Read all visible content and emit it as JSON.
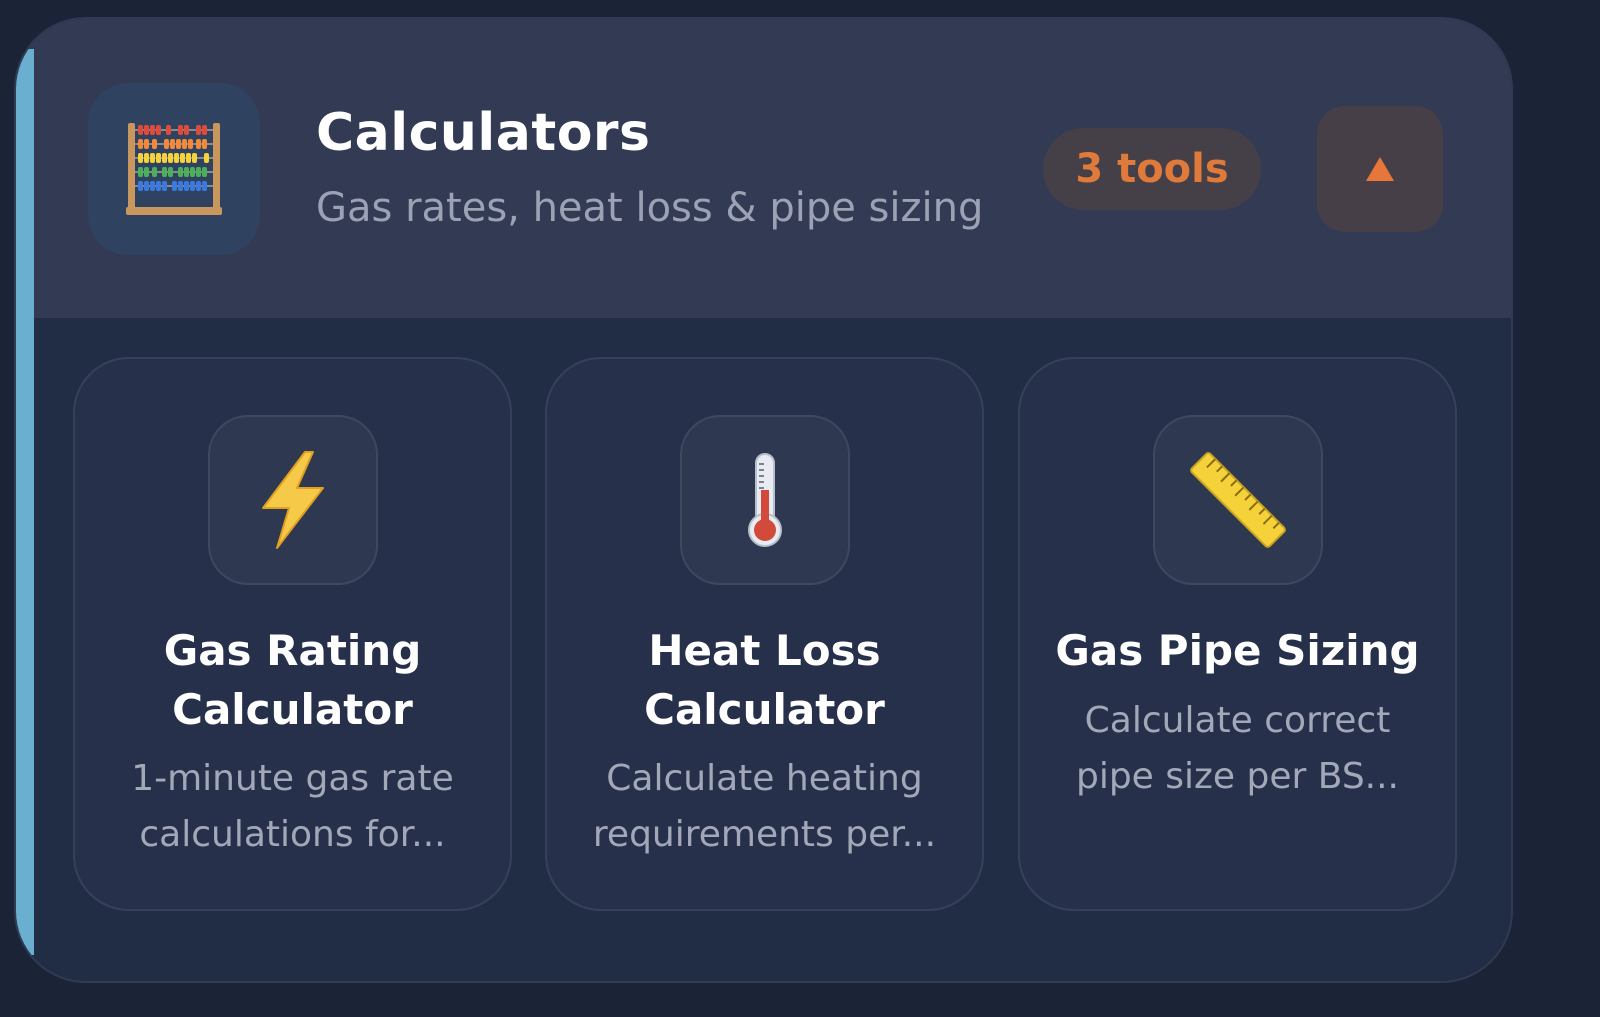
{
  "section": {
    "title": "Calculators",
    "subtitle": "Gas rates, heat loss & pipe sizing",
    "icon": "abacus-icon",
    "badge": "3 tools",
    "collapse_icon": "triangle-up-icon",
    "colors": {
      "background": "#1b2336",
      "card": "#212c45",
      "header": "#333a54",
      "accent_bar": "#6aaed0",
      "badge_text": "#e07a3a"
    }
  },
  "tools": [
    {
      "title_line1": "Gas Rating",
      "title_line2": "Calculator",
      "desc_line1": "1-minute gas rate",
      "desc_line2": "calculations for...",
      "icon": "lightning-icon"
    },
    {
      "title_line1": "Heat Loss",
      "title_line2": "Calculator",
      "desc_line1": "Calculate heating",
      "desc_line2": "requirements per...",
      "icon": "thermometer-icon"
    },
    {
      "title_line1": "Gas Pipe Sizing",
      "title_line2": "",
      "desc_line1": "Calculate correct",
      "desc_line2": "pipe size per BS...",
      "icon": "ruler-icon"
    }
  ]
}
